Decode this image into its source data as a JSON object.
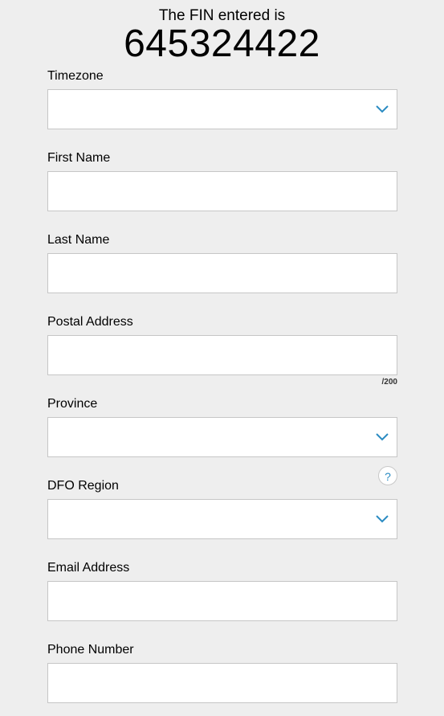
{
  "header": {
    "caption": "The FIN entered is",
    "fin": "645324422"
  },
  "colors": {
    "accent": "#2a8bc2",
    "background": "#eeeeee",
    "border": "#c6c6c6"
  },
  "fields": {
    "timezone": {
      "label": "Timezone",
      "value": "",
      "icon": "chevron-down-icon"
    },
    "first_name": {
      "label": "First Name",
      "value": ""
    },
    "last_name": {
      "label": "Last Name",
      "value": ""
    },
    "postal_address": {
      "label": "Postal Address",
      "value": "",
      "counter": "/200"
    },
    "province": {
      "label": "Province",
      "value": "",
      "icon": "chevron-down-icon"
    },
    "dfo_region": {
      "label": "DFO Region",
      "value": "",
      "icon": "chevron-down-icon",
      "help": "?"
    },
    "email": {
      "label": "Email Address",
      "value": ""
    },
    "phone": {
      "label": "Phone Number",
      "value": ""
    }
  }
}
